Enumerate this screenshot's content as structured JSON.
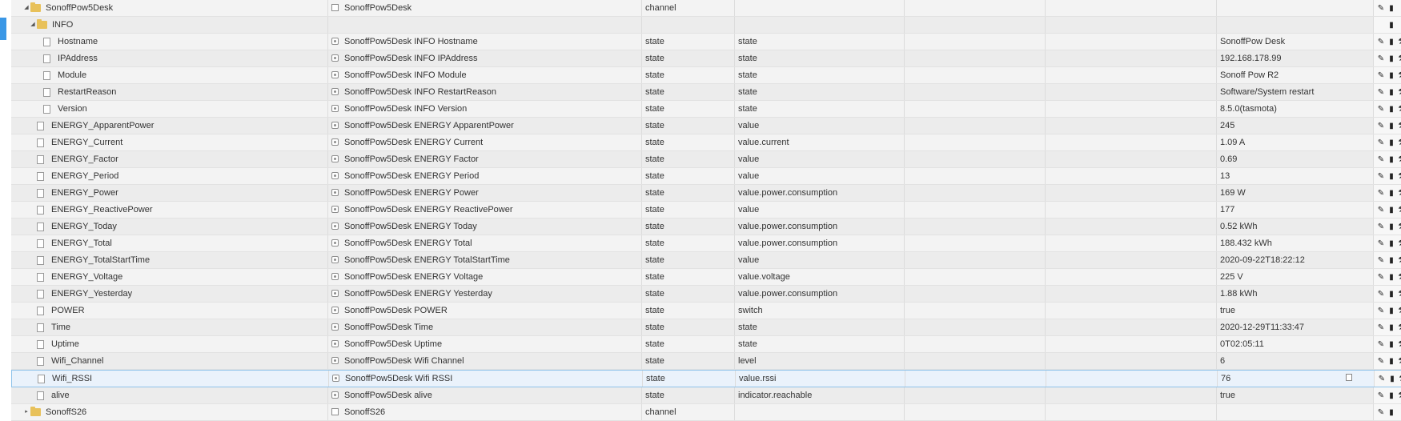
{
  "rows": [
    {
      "name": "SonoffPow5Desk",
      "label": "SonoffPow5Desk",
      "type": "channel",
      "role": "",
      "value": "",
      "kind": "folder",
      "level": 1,
      "open": true,
      "labelIcon": "channel"
    },
    {
      "name": "INFO",
      "label": "",
      "type": "",
      "role": "",
      "value": "",
      "kind": "folder",
      "level": 2,
      "open": true,
      "labelIcon": ""
    },
    {
      "name": "Hostname",
      "label": "SonoffPow5Desk INFO Hostname",
      "type": "state",
      "role": "state",
      "value": "SonoffPow Desk",
      "kind": "file",
      "level": 3
    },
    {
      "name": "IPAddress",
      "label": "SonoffPow5Desk INFO IPAddress",
      "type": "state",
      "role": "state",
      "value": "192.168.178.99",
      "kind": "file",
      "level": 3
    },
    {
      "name": "Module",
      "label": "SonoffPow5Desk INFO Module",
      "type": "state",
      "role": "state",
      "value": "Sonoff Pow R2",
      "kind": "file",
      "level": 3
    },
    {
      "name": "RestartReason",
      "label": "SonoffPow5Desk INFO RestartReason",
      "type": "state",
      "role": "state",
      "value": "Software/System restart",
      "kind": "file",
      "level": 3
    },
    {
      "name": "Version",
      "label": "SonoffPow5Desk INFO Version",
      "type": "state",
      "role": "state",
      "value": "8.5.0(tasmota)",
      "kind": "file",
      "level": 3
    },
    {
      "name": "ENERGY_ApparentPower",
      "label": "SonoffPow5Desk ENERGY ApparentPower",
      "type": "state",
      "role": "value",
      "value": "245",
      "kind": "file",
      "level": 2
    },
    {
      "name": "ENERGY_Current",
      "label": "SonoffPow5Desk ENERGY Current",
      "type": "state",
      "role": "value.current",
      "value": "1.09 A",
      "kind": "file",
      "level": 2
    },
    {
      "name": "ENERGY_Factor",
      "label": "SonoffPow5Desk ENERGY Factor",
      "type": "state",
      "role": "value",
      "value": "0.69",
      "kind": "file",
      "level": 2
    },
    {
      "name": "ENERGY_Period",
      "label": "SonoffPow5Desk ENERGY Period",
      "type": "state",
      "role": "value",
      "value": "13",
      "kind": "file",
      "level": 2
    },
    {
      "name": "ENERGY_Power",
      "label": "SonoffPow5Desk ENERGY Power",
      "type": "state",
      "role": "value.power.consumption",
      "value": "169 W",
      "kind": "file",
      "level": 2
    },
    {
      "name": "ENERGY_ReactivePower",
      "label": "SonoffPow5Desk ENERGY ReactivePower",
      "type": "state",
      "role": "value",
      "value": "177",
      "kind": "file",
      "level": 2
    },
    {
      "name": "ENERGY_Today",
      "label": "SonoffPow5Desk ENERGY Today",
      "type": "state",
      "role": "value.power.consumption",
      "value": "0.52 kWh",
      "kind": "file",
      "level": 2
    },
    {
      "name": "ENERGY_Total",
      "label": "SonoffPow5Desk ENERGY Total",
      "type": "state",
      "role": "value.power.consumption",
      "value": "188.432 kWh",
      "kind": "file",
      "level": 2
    },
    {
      "name": "ENERGY_TotalStartTime",
      "label": "SonoffPow5Desk ENERGY TotalStartTime",
      "type": "state",
      "role": "value",
      "value": "2020-09-22T18:22:12",
      "kind": "file",
      "level": 2
    },
    {
      "name": "ENERGY_Voltage",
      "label": "SonoffPow5Desk ENERGY Voltage",
      "type": "state",
      "role": "value.voltage",
      "value": "225 V",
      "kind": "file",
      "level": 2
    },
    {
      "name": "ENERGY_Yesterday",
      "label": "SonoffPow5Desk ENERGY Yesterday",
      "type": "state",
      "role": "value.power.consumption",
      "value": "1.88 kWh",
      "kind": "file",
      "level": 2
    },
    {
      "name": "POWER",
      "label": "SonoffPow5Desk POWER",
      "type": "state",
      "role": "switch",
      "value": "true",
      "kind": "file",
      "level": 2
    },
    {
      "name": "Time",
      "label": "SonoffPow5Desk Time",
      "type": "state",
      "role": "state",
      "value": "2020-12-29T11:33:47",
      "kind": "file",
      "level": 2
    },
    {
      "name": "Uptime",
      "label": "SonoffPow5Desk Uptime",
      "type": "state",
      "role": "state",
      "value": "0T02:05:11",
      "kind": "file",
      "level": 2
    },
    {
      "name": "Wifi_Channel",
      "label": "SonoffPow5Desk Wifi Channel",
      "type": "state",
      "role": "level",
      "value": "6",
      "kind": "file",
      "level": 2
    },
    {
      "name": "Wifi_RSSI",
      "label": "SonoffPow5Desk Wifi RSSI",
      "type": "state",
      "role": "value.rssi",
      "value": "76",
      "kind": "file",
      "level": 2,
      "selected": true
    },
    {
      "name": "alive",
      "label": "SonoffPow5Desk alive",
      "type": "state",
      "role": "indicator.reachable",
      "value": "true",
      "kind": "file",
      "level": 2
    },
    {
      "name": "SonoffS26",
      "label": "SonoffS26",
      "type": "channel",
      "role": "",
      "value": "",
      "kind": "folder",
      "level": 1,
      "open": false,
      "labelIcon": "channel"
    }
  ],
  "icons": {
    "expanded": "triangle-down-icon",
    "collapsed": "triangle-right-icon",
    "edit": "pencil-icon",
    "delete": "trash-icon",
    "more": "wrench-icon",
    "copy": "copy-icon"
  },
  "colors": {
    "accent": "#3a97e6",
    "folder": "#e8c15a",
    "selected_border": "#8fc3ea"
  }
}
